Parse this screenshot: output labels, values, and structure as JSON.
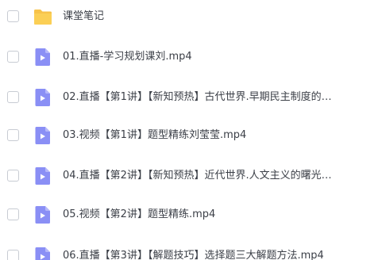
{
  "file_list": {
    "items": [
      {
        "type": "folder",
        "icon": "folder-icon",
        "name": "课堂笔记"
      },
      {
        "type": "video",
        "icon": "video-file-icon",
        "name": "01.直播-学习规划课刘.mp4"
      },
      {
        "type": "video",
        "icon": "video-file-icon",
        "name": "02.直播【第1讲】【新知预热】古代世界.早期民主制度的…"
      },
      {
        "type": "video",
        "icon": "video-file-icon",
        "name": "03.视频【第1讲】题型精练刘莹莹.mp4"
      },
      {
        "type": "video",
        "icon": "video-file-icon",
        "name": "04.直播【第2讲】【新知预热】近代世界.人文主义的曙光…"
      },
      {
        "type": "video",
        "icon": "video-file-icon",
        "name": "05.视频【第2讲】题型精练.mp4"
      },
      {
        "type": "video",
        "icon": "video-file-icon",
        "name": "06.直播【第3讲】【解题技巧】选择题三大解题方法.mp4"
      }
    ],
    "colors": {
      "folder": "#f7c34a",
      "video": "#8a8ff5",
      "text": "#3b3f47",
      "checkbox_border": "#c8ccd3"
    }
  }
}
